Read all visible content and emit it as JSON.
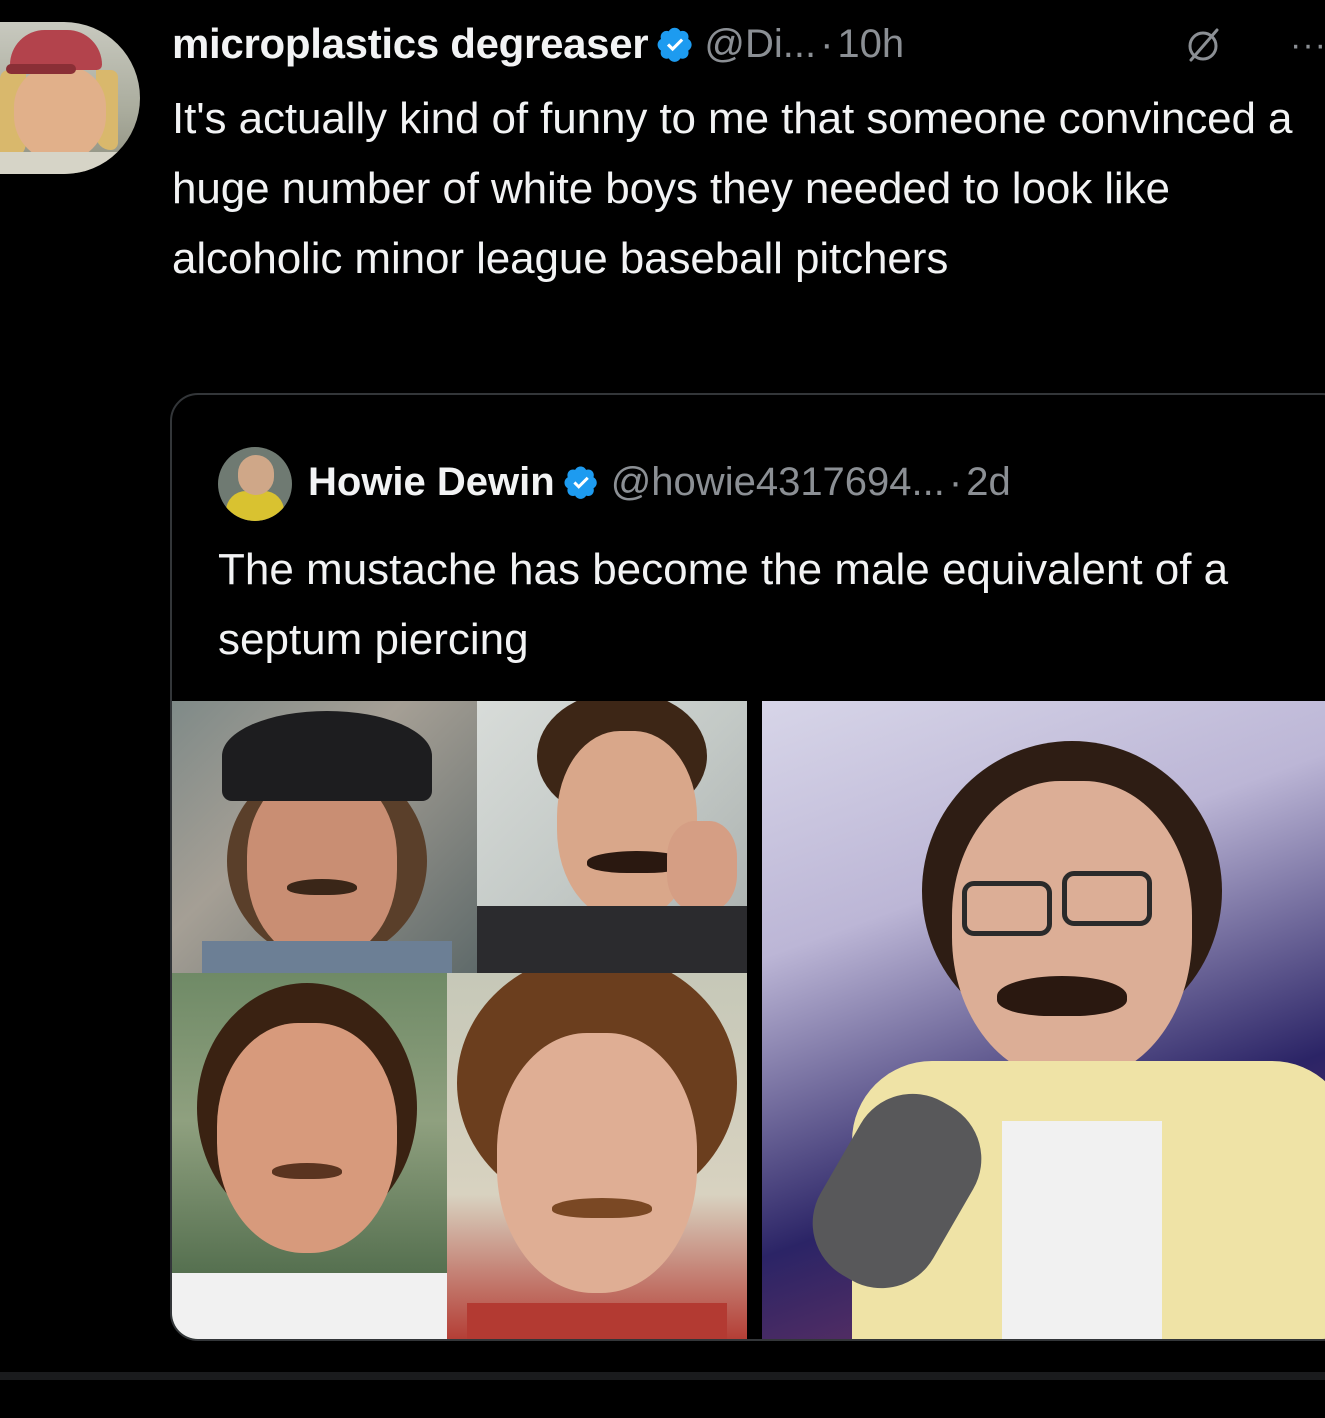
{
  "tweet": {
    "author": {
      "display_name": "microplastics degreaser",
      "handle": "@Di...",
      "verified": true,
      "avatar_icon": "user-avatar"
    },
    "separator": "·",
    "time": "10h",
    "text": "It's actually kind of funny to me that someone convinced a huge number of white boys they needed to look like alcoholic minor league baseball pitchers"
  },
  "quote": {
    "author": {
      "display_name": "Howie Dewin",
      "handle": "@howie4317694...",
      "verified": true,
      "avatar_icon": "user-avatar"
    },
    "separator": "·",
    "time": "2d",
    "text": "The mustache has become the male equivalent of a septum piercing",
    "media_count": 5
  },
  "colors": {
    "background": "#000000",
    "text": "#e7e9ea",
    "secondary": "#8b8f94",
    "verified_badge": "#1d9bf0",
    "border": "#333639"
  }
}
